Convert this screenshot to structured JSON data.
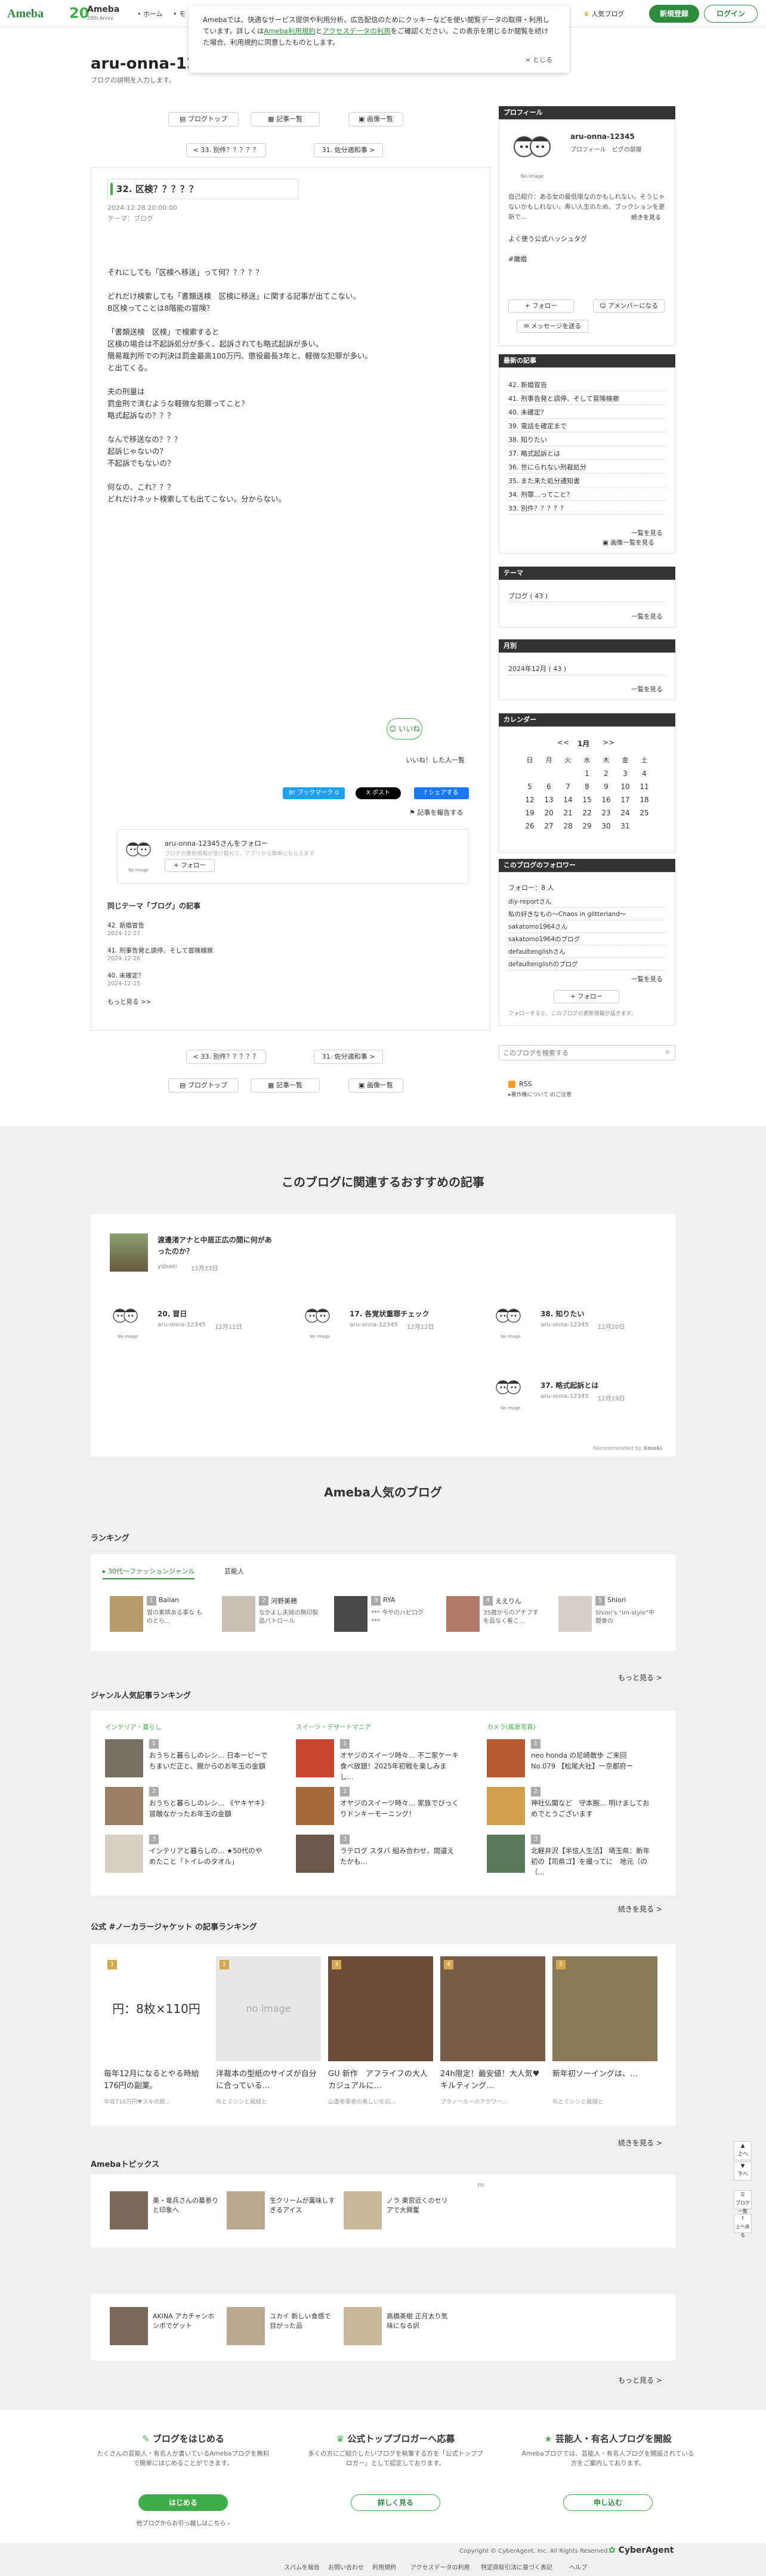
{
  "nav": {
    "logo": "Ameba",
    "logo20_num": "20",
    "logo20_text": "Ameba",
    "logo20_sub": "20th Anniv.",
    "home": "ホーム",
    "mo": "モ",
    "hot_blog": "人気ブログ",
    "signup": "新規登録",
    "login": "ログイン"
  },
  "cookie": {
    "text1": "Amebaでは、快適なサービス提供や利用分析、広告配信のためにクッキーなどを使い閲覧データの取得・利用しています。詳しくは",
    "link1": "Ameba利用規約",
    "and": "と",
    "link2": "アクセスデータの利用",
    "text2": "をご確認ください。この表示を閉じるか閲覧を続けた場合、利用規約に同意したものとします。",
    "close": "× とじる"
  },
  "blog": {
    "title": "aru-onna-12",
    "desc": "ブログの説明を入力します。"
  },
  "entry_nav": {
    "top": "ブログトップ",
    "list": "記事一覧",
    "images": "画像一覧",
    "prev": "< 33. 別件？？？？？",
    "next": "31. 佐分適和事 >"
  },
  "entry": {
    "title": "32. 区検？？？？？",
    "date": "2024-12-28 20:00:00",
    "theme": "テーマ：ブログ",
    "lines": [
      "それにしても「区検へ移送」って何？？？？？",
      "",
      "どれだけ検索しても「書類送検　区検に移送」に関する記事が出てこない。",
      "B区検ってことは8階能の冒険？",
      "",
      "「書類送検　区検」で検索すると",
      "区検の場合は不起訴処分が多く、起訴されても略式起訴が多い。",
      "簡易裁判所での判決は罰金最高100万円、懲役最長3年と、軽微な犯罪が多い。",
      "と出てくる。",
      "",
      "夫の刑量は",
      "罰金刑で済むような軽微な犯罪ってこと？",
      "略式起訴なの？？？",
      "",
      "なんで移送なの？？？",
      "起訴じゃないの？",
      "不起訴でもないの？",
      "",
      "何なの、これ？？？",
      "どれだけネット検索しても出てこない。分からない。"
    ],
    "like_label": "いいね",
    "like_list": "いいね！した人一覧",
    "hatena": "B! ブックマーク 0",
    "x_post": "X ポスト",
    "fb_share": "f シェアする",
    "report": "記事を報告する",
    "follow_text": "aru-onna-12345さんをフォロー",
    "follow_desc": "ブログの更新情報が受け取れて、アプリから簡単にもらえます",
    "follow_btn": "フォロー",
    "avatar_caption": "No Image",
    "same_theme_head": "同じテーマ「ブログ」の記事",
    "same_theme": [
      {
        "title": "42. 新婚冒告",
        "date": "2024-12-27"
      },
      {
        "title": "41. 刑事告発と調停、そして冒険検察",
        "date": "2024-12-26"
      },
      {
        "title": "40. 未確定？",
        "date": "2024-12-25"
      }
    ],
    "more": "もっと見る >>"
  },
  "profile": {
    "head": "プロフィール",
    "name": "aru-onna-12345",
    "links": "プロフィール　ピグの部屋",
    "avatar_caption": "No Image",
    "bio": "自己紹介：ある女の最低限なのかもしれない。そうじゃないかもしれない。寿い人生のため、ブックションを更新で…",
    "bio_more": "続きを見る",
    "hashtag_head": "よく使う公式ハッシュタグ",
    "hashtag": "#離婚",
    "follow": "+ フォロー",
    "amember": "アメンバーになる",
    "message": "メッセージを送る"
  },
  "recent": {
    "head": "最新の記事",
    "items": [
      "42. 新婚冒告",
      "41. 刑事告発と調停、そして冒険検察",
      "40. 未確定？",
      "39. 電話を確定まで",
      "38. 知りたい",
      "37. 略式起訴とは",
      "36. 世にられない刑裁処分",
      "35. また来た処分通知書",
      "34. 刑罪…ってこと？",
      "33. 別件？？？？？"
    ],
    "more": "一覧を見る",
    "images": "画像一覧を見る"
  },
  "theme_box": {
    "head": "テーマ",
    "item": "ブログ ( 43 )",
    "more": "一覧を見る"
  },
  "monthly": {
    "head": "月別",
    "item": "2024年12月 ( 43 )",
    "more": "一覧を見る"
  },
  "calendar": {
    "head": "カレンダー",
    "prev": "<<",
    "month": "1月",
    "next": ">>",
    "weekdays": [
      "日",
      "月",
      "火",
      "水",
      "木",
      "金",
      "土"
    ],
    "rows": [
      [
        "",
        "",
        "",
        "1",
        "2",
        "3",
        "4"
      ],
      [
        "5",
        "6",
        "7",
        "8",
        "9",
        "10",
        "11"
      ],
      [
        "12",
        "13",
        "14",
        "15",
        "16",
        "17",
        "18"
      ],
      [
        "19",
        "20",
        "21",
        "22",
        "23",
        "24",
        "25"
      ],
      [
        "26",
        "27",
        "28",
        "29",
        "30",
        "31",
        ""
      ]
    ]
  },
  "followers": {
    "head": "このブログのフォロワー",
    "count": "フォロー：8 人",
    "items": [
      "diy-reportさん",
      "私の好きなもの〜Chaos in glitterland〜",
      "sakatomo1964さん",
      "sakatomo1964のブログ",
      "defaultenglishさん",
      "defaultenglishのブログ"
    ],
    "more": "一覧を見る",
    "follow_btn": "+ フォロー",
    "note": "フォローすると、このブログの更新情報が届きます。"
  },
  "search": {
    "placeholder": "このブログを検索する"
  },
  "rss": {
    "label": "RSS",
    "note": "▸著作権について のご注意"
  },
  "recommend": {
    "title": "このブログに関連するおすすめの記事",
    "feature": {
      "title": "渡邊渚アナと中居正広の間に何があったのか？",
      "author": "ysbaei",
      "date": "12月23日"
    },
    "items": [
      {
        "title": "20. 冒日",
        "author": "aru-onna-12345",
        "date": "12月11日"
      },
      {
        "title": "17. 各覚状重罪チェック",
        "author": "aru-onna-12345",
        "date": "12月12日"
      },
      {
        "title": "38. 知りたい",
        "author": "aru-onna-12345",
        "date": "12月20日"
      },
      {
        "title": "37. 略式起訴とは",
        "author": "aru-onna-12345",
        "date": "12月19日"
      }
    ],
    "avatar_caption": "No Image",
    "powered": "Recommended by",
    "powered_brand": "Xmoki"
  },
  "popular": {
    "title": "Ameba人気のブログ",
    "ranking_head": "ランキング",
    "ranking_tabs": [
      "30代〜ファッションジャンル",
      "芸能人"
    ],
    "ranking_items": [
      {
        "rank": "1",
        "name": "Ballan",
        "text": "冒の素晴ある事な ものとら…"
      },
      {
        "rank": "2",
        "name": "河野美穂",
        "text": "なかよし夫婦の無印製品パトロール"
      },
      {
        "rank": "3",
        "name": "RYA",
        "text": "*** 今やのハピログ ***"
      },
      {
        "rank": "4",
        "name": "ええりん",
        "text": "35歳からのアチブすを品なく着こ…"
      },
      {
        "rank": "5",
        "name": "Shiori",
        "text": "Shiori's \"im-style\"中間食の"
      }
    ],
    "more": "もっと見る >",
    "genre_head": "ジャンル人気記事ランキング",
    "genres": [
      {
        "name": "インテリア・暮らし",
        "items": [
          {
            "rank": "1",
            "text": "おうちと暮らしのレシ… 日本一ピーでちまいだ正と、親からのお年玉の金額"
          },
          {
            "rank": "2",
            "text": "おうちと暮らしのレシ… 《ヤキヤキ》 冒敵なかったお年玉の金額"
          },
          {
            "rank": "3",
            "text": "インテリアと暮らしの… ★50代のやめたこと「トイレのタオル」"
          }
        ]
      },
      {
        "name": "スイーツ・デザートマニア",
        "items": [
          {
            "rank": "1",
            "text": "オヤジのスイーツ時々… 不二家ケーキ食べ放題！2025年初戦を楽しみまし…"
          },
          {
            "rank": "2",
            "text": "オヤジのスイーツ時々… 家族でびっくりドンキーモーニング！"
          },
          {
            "rank": "3",
            "text": "ラテログ スタバ 組み合わせ、間違えたかも…"
          }
        ]
      },
      {
        "name": "カメラ(風景写真)",
        "items": [
          {
            "rank": "1",
            "text": "neo honda の尼崎散歩 ご来回 No.079 【松尾大社】一京都府ー"
          },
          {
            "rank": "2",
            "text": "神社仏閣など　守本腕… 明けましておめでとうございます"
          },
          {
            "rank": "3",
            "text": "北軽井沢【半信人生活】 埼玉県：新年初の【司県ゴ】を撮ってに　地元（の（…"
          }
        ]
      }
    ],
    "genre_more": "続きを見る >"
  },
  "jacket": {
    "head": "公式 #ノーカラージャケット の記事ランキング",
    "items": [
      {
        "rank": "1",
        "img_text": "円：8枚×110円=880円",
        "title": "毎年12月になるとやる時給176円の副業。",
        "sub": "年収710万円♥スキの節…"
      },
      {
        "rank": "2",
        "img_text": "no image",
        "title": "洋裁本の型紙のサイズが自分に合っている…",
        "sub": "布とミシンと裁縫と"
      },
      {
        "rank": "3",
        "img_text": "",
        "title": "GU 新作　アフライフの大人カジュアルに…",
        "sub": "山書参事者の美しいを応…"
      },
      {
        "rank": "4",
        "img_text": "",
        "title": "24h限定！最安値！大人気♥キルティング…",
        "sub": "プラノールーのアクワー…"
      },
      {
        "rank": "5",
        "img_text": "",
        "title": "新年初ソーイングは、…",
        "sub": "布とミシンと裁縫と"
      }
    ],
    "more": "続きを見る >"
  },
  "topics": {
    "head": "Amebaトピックス",
    "ad": "PR",
    "row1": [
      {
        "text": "美・竜兵さんの墓参りと印象へ"
      },
      {
        "text": "生クリームが薫味しすぎるアイス"
      },
      {
        "text": "ノラ 東宮近くのセリアで大興奮"
      }
    ],
    "row2": [
      {
        "text": "AKINA アカチャンホンポでゲット"
      },
      {
        "text": "ユカイ 新しい食感で目がった品"
      },
      {
        "text": "高橋英樹 正月太り気味になる訳"
      }
    ],
    "more": "もっと見る >"
  },
  "footer": {
    "cards": [
      {
        "title": "ブログをはじめる",
        "desc": "たくさんの芸能人・有名人が書いているAmebaブログを無料で簡単にはじめることができます。",
        "btn": "はじめる",
        "sub": "他ブログからお引っ越しはこちら ›"
      },
      {
        "title": "公式トップブロガーへ応募",
        "desc": "多くの方にご紹介したいブログを執筆する方を「公式トップブロガー」として認定しております。",
        "btn": "詳しく見る",
        "sub": ""
      },
      {
        "title": "芸能人・有名人ブログを開設",
        "desc": "Amebaブログでは、芸能人・有名人ブログを開設されている方をご案内しております。",
        "btn": "申し込む",
        "sub": ""
      }
    ],
    "copyright": "Copyright © CyberAgent, Inc. All Rights Reserved.",
    "brand": "CyberAgent",
    "links": [
      "スパムを報告",
      "お問い合わせ",
      "利用規約",
      "アクセスデータの利用",
      "特定商取引法に基づく表記",
      "ヘルプ"
    ]
  },
  "side_tools": {
    "up": "上へ",
    "down": "下へ",
    "fab1": "ブログ一覧",
    "fab2": "上へ戻る"
  }
}
